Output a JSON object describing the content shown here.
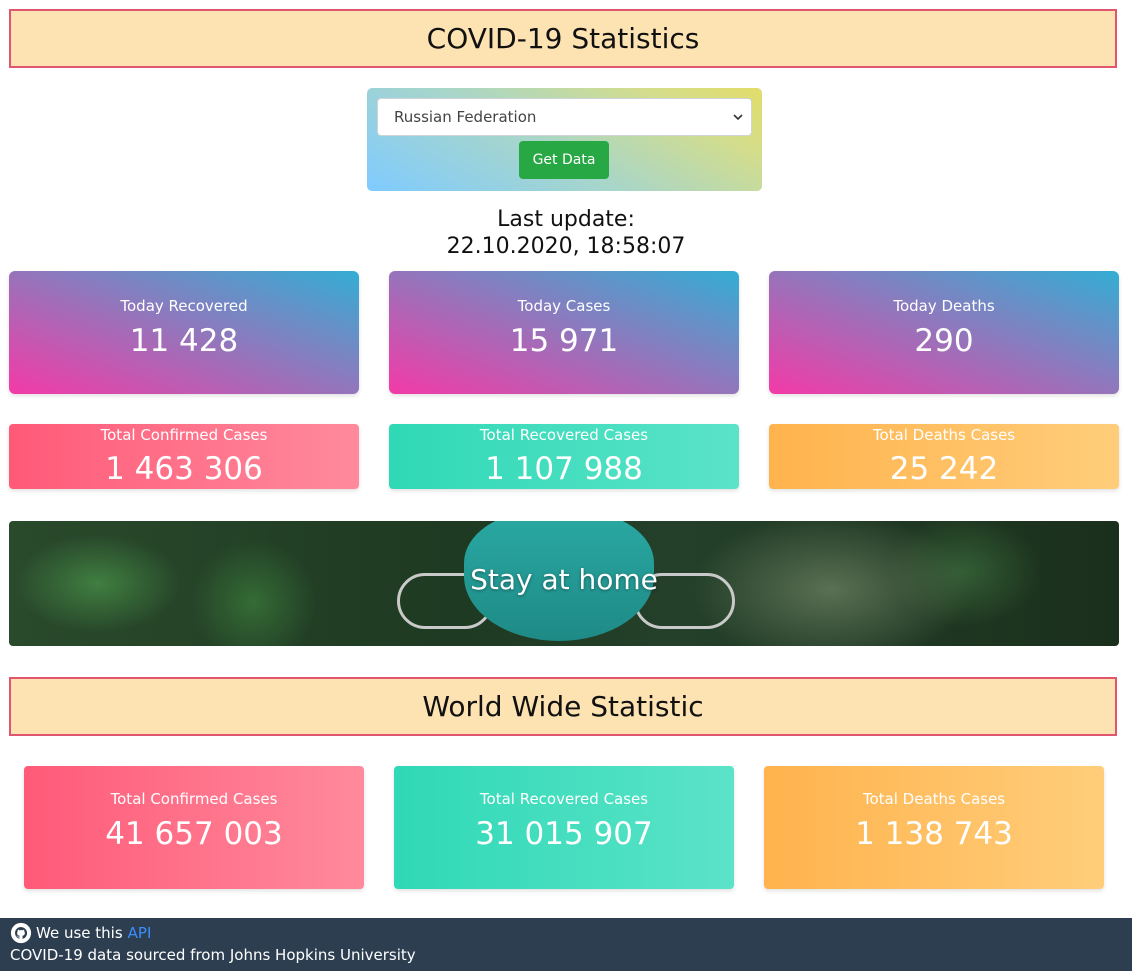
{
  "header": {
    "title": "COVID-19 Statistics"
  },
  "selector": {
    "selected_country": "Russian Federation",
    "button_label": "Get Data"
  },
  "last_update": {
    "label": "Last update:",
    "timestamp": "22.10.2020, 18:58:07"
  },
  "today": [
    {
      "label": "Today Recovered",
      "value": "11 428"
    },
    {
      "label": "Today Cases",
      "value": "15 971"
    },
    {
      "label": "Today Deaths",
      "value": "290"
    }
  ],
  "totals": [
    {
      "label": "Total Confirmed Cases",
      "value": "1 463 306",
      "color": "#ff5a78"
    },
    {
      "label": "Total Recovered Cases",
      "value": "1 107 988",
      "color": "#2fd9b6"
    },
    {
      "label": "Total Deaths Cases",
      "value": "25 242",
      "color": "#ffb34d"
    }
  ],
  "banner": {
    "text": "Stay at home"
  },
  "world": {
    "title": "World Wide Statistic",
    "cards": [
      {
        "label": "Total Confirmed Cases",
        "value": "41 657 003"
      },
      {
        "label": "Total Recovered Cases",
        "value": "31 015 907"
      },
      {
        "label": "Total Deaths Cases",
        "value": "1 138 743"
      }
    ]
  },
  "footer": {
    "line1_prefix": "We use this",
    "api_link": "API",
    "line2": "COVID-19 data sourced from Johns Hopkins University"
  },
  "colors": {
    "title_bg": "#fde2b2",
    "title_border": "#e0566f",
    "button_green": "#28a745",
    "footer_bg": "#2c3e50",
    "link_blue": "#3b8eff"
  }
}
